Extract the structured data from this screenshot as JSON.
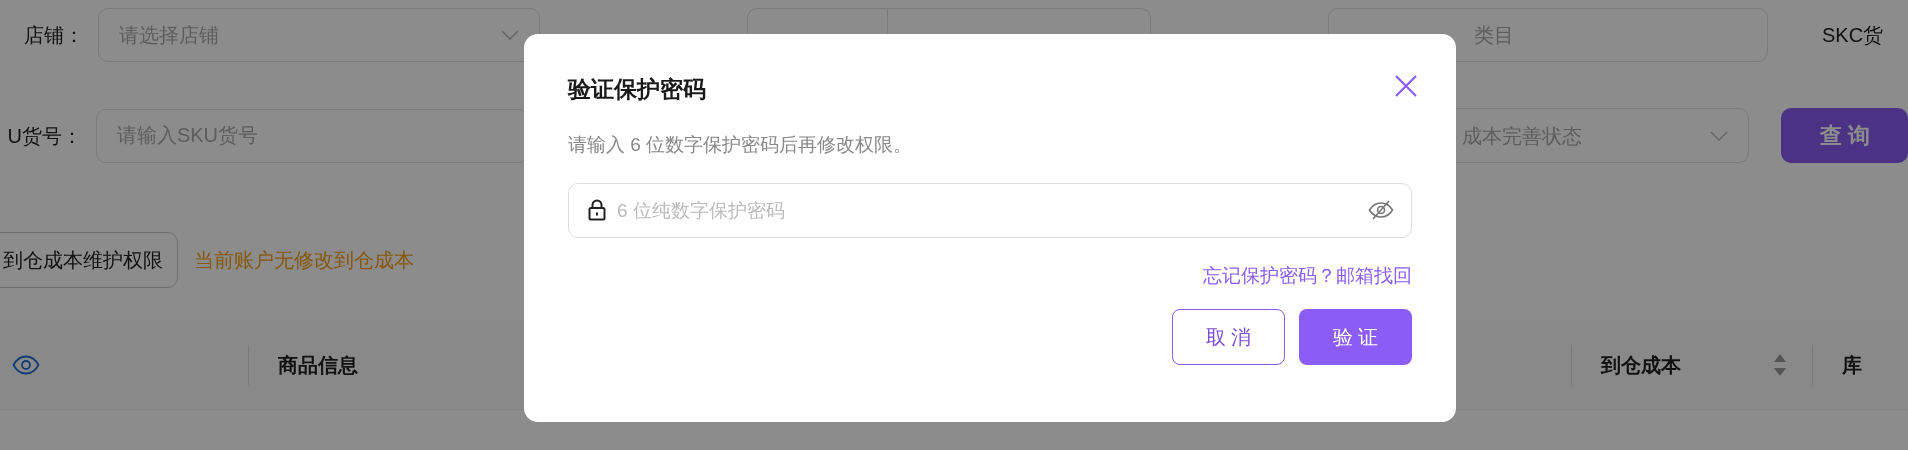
{
  "filters": {
    "store": {
      "label": "店铺：",
      "placeholder": "请选择店铺"
    },
    "category": {
      "placeholder": "类目"
    },
    "skc_label": "SKC货",
    "sku": {
      "label": "U货号：",
      "placeholder": "请输入SKU货号"
    },
    "cost_status": {
      "placeholder": "成本完善状态"
    },
    "query_button": "查 询"
  },
  "permission_button": "到仓成本维护权限",
  "permission_warning": "当前账户无修改到仓成本",
  "table": {
    "columns": [
      {
        "label": "商品信息"
      },
      {
        "label": "到仓成本",
        "sortable": true
      },
      {
        "label": "库"
      }
    ]
  },
  "dialog": {
    "title": "验证保护密码",
    "description": "请输入 6 位数字保护密码后再修改权限。",
    "password_placeholder": "6 位纯数字保护密码",
    "forgot_link": "忘记保护密码？邮箱找回",
    "buttons": [
      {
        "label": "取 消",
        "kind": "secondary"
      },
      {
        "label": "验 证",
        "kind": "primary"
      }
    ]
  }
}
